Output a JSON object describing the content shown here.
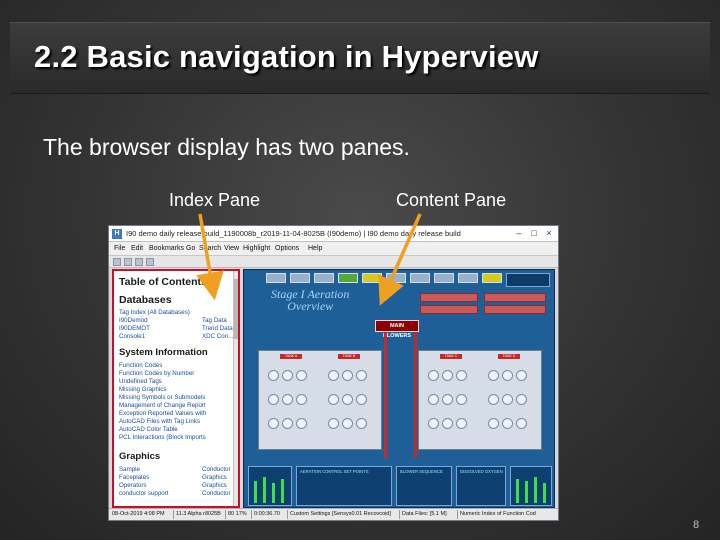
{
  "slide": {
    "title": "2.2  Basic navigation in Hyperview",
    "body": "The browser display has two panes.",
    "label_index": "Index Pane",
    "label_content": "Content Pane",
    "page_number": "8"
  },
  "app": {
    "window_title": "I90 demo daily release build_1190008b_r2019-11-04-8025B (I90demo) | I90 demo daily release build",
    "menu": [
      "File",
      "Edit",
      "Bookmarks",
      "Go",
      "Search",
      "View",
      "Highlight",
      "Options",
      "Help"
    ],
    "index_pane": {
      "toc_heading": "Table of Contents",
      "databases_heading": "Databases",
      "databases_items": [
        {
          "left": "Tag Index (All Databases)",
          "right": ""
        },
        {
          "left": "I90Demod",
          "right": "Tag Data"
        },
        {
          "left": "I90DEMOT",
          "right": "Trend Data"
        },
        {
          "left": "Console1",
          "right": "XDC Con..."
        }
      ],
      "system_heading": "System Information",
      "system_items": [
        "Function Codes",
        "Function Codes by Number",
        "Undefined Tags",
        "Missing Graphics",
        "Missing Symbols or Submodels",
        "Management of Change Report",
        "Exception Reported Values with",
        "AutoCAD Files with Tag Links",
        "AutoCAD Color Table",
        "PCL Interactions (Block Imports"
      ],
      "graphics_heading": "Graphics",
      "graphics_items": [
        {
          "left": "Sample",
          "right": "Conductor"
        },
        {
          "left": "Faceplates",
          "right": "Graphics"
        },
        {
          "left": "Operators",
          "right": "Graphics"
        },
        {
          "left": "conductor support",
          "right": "Conductor"
        }
      ]
    },
    "content_pane": {
      "title_line1": "Stage I Aeration",
      "title_line2": "Overview",
      "blower_label": "MAIN BLOWERS",
      "stage_labels": [
        "TANK A",
        "TANK B",
        "TANK C",
        "TANK D"
      ],
      "bottom_left_heading": "AERATION CONTROL SET POINTS",
      "bottom_mid_heading": "BLOWER SEQUENCE",
      "bottom_right_heading": "DISSOLVED OXYGEN"
    },
    "statusbar": [
      "08-Oct-2019 4:08 PM",
      "11.3 Alpha r8025B",
      "80 17%",
      "0:00:36.70",
      "Custom Settings [Sensys0.01 Recovcoid]",
      "Data Files: [5.1 M]",
      "Numeric Index of Function Cod"
    ]
  }
}
